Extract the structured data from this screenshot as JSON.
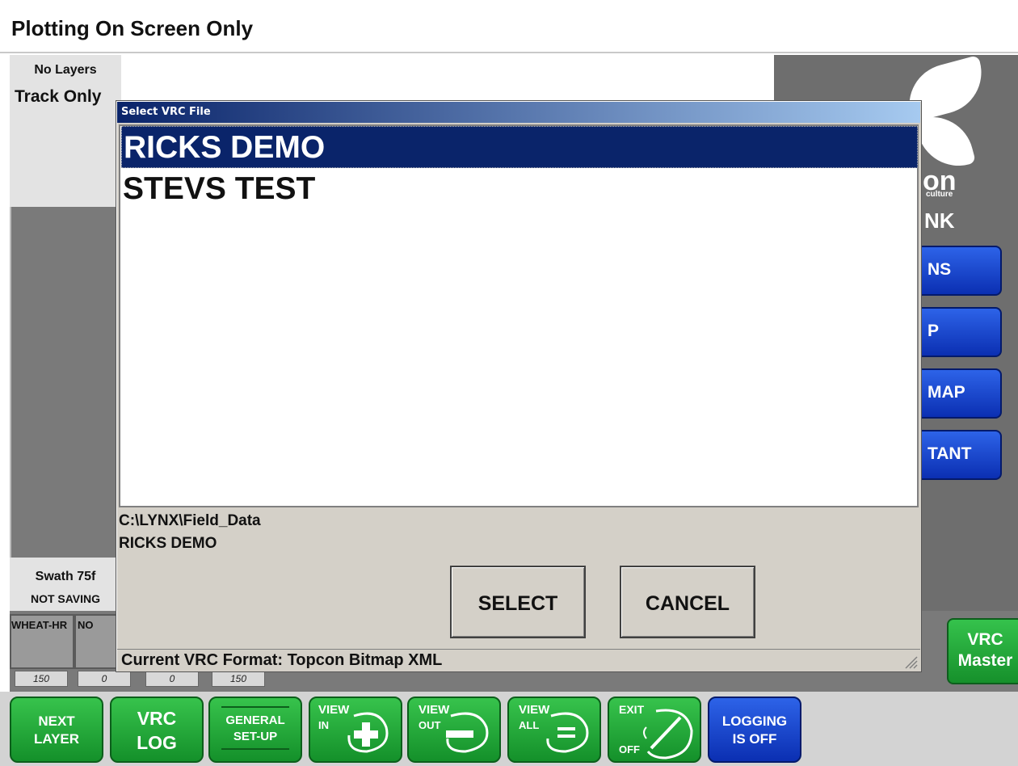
{
  "header": {
    "title": "Plotting On Screen Only"
  },
  "left_panel": {
    "layers_label": "No Layers",
    "track_label": "Track Only",
    "swath_label": "Swath 75f",
    "saving_label": "NOT SAVING"
  },
  "right_panel": {
    "logo_text_a": "on",
    "logo_text_b": "culture",
    "logo_text_c": "NK",
    "buttons": [
      "NS",
      "P",
      "MAP",
      "TANT"
    ]
  },
  "counters": [
    {
      "label": "WHEAT-HR",
      "value": "150"
    },
    {
      "label": "NO",
      "value": "0"
    },
    {
      "label": "",
      "value": "0"
    },
    {
      "label": "",
      "value": "150"
    }
  ],
  "vrc_master": {
    "line1": "VRC",
    "line2": "Master"
  },
  "dialog": {
    "title": "Select VRC File",
    "files": [
      "RICKS DEMO",
      "STEVS TEST"
    ],
    "selected_index": 0,
    "path": "C:\\LYNX\\Field_Data",
    "selected_file": "RICKS DEMO",
    "select_label": "SELECT",
    "cancel_label": "CANCEL",
    "status": "Current VRC Format: Topcon Bitmap XML"
  },
  "toolbar": {
    "next_layer": {
      "line1": "NEXT",
      "line2": "LAYER"
    },
    "vrc_log": {
      "line1": "VRC",
      "line2": "LOG"
    },
    "general_setup": {
      "line1": "GENERAL",
      "line2": "SET-UP"
    },
    "view_in": {
      "line1": "VIEW",
      "line2": "IN"
    },
    "view_out": {
      "line1": "VIEW",
      "line2": "OUT"
    },
    "view_all": {
      "line1": "VIEW",
      "line2": "ALL"
    },
    "exit": {
      "line1": "EXIT",
      "line2": "OFF"
    },
    "logging": {
      "line1": "LOGGING",
      "line2": "IS OFF"
    }
  },
  "colors": {
    "green_button": "#1fa63a",
    "blue_button": "#1846d0",
    "title_bar": "#0a246a"
  }
}
